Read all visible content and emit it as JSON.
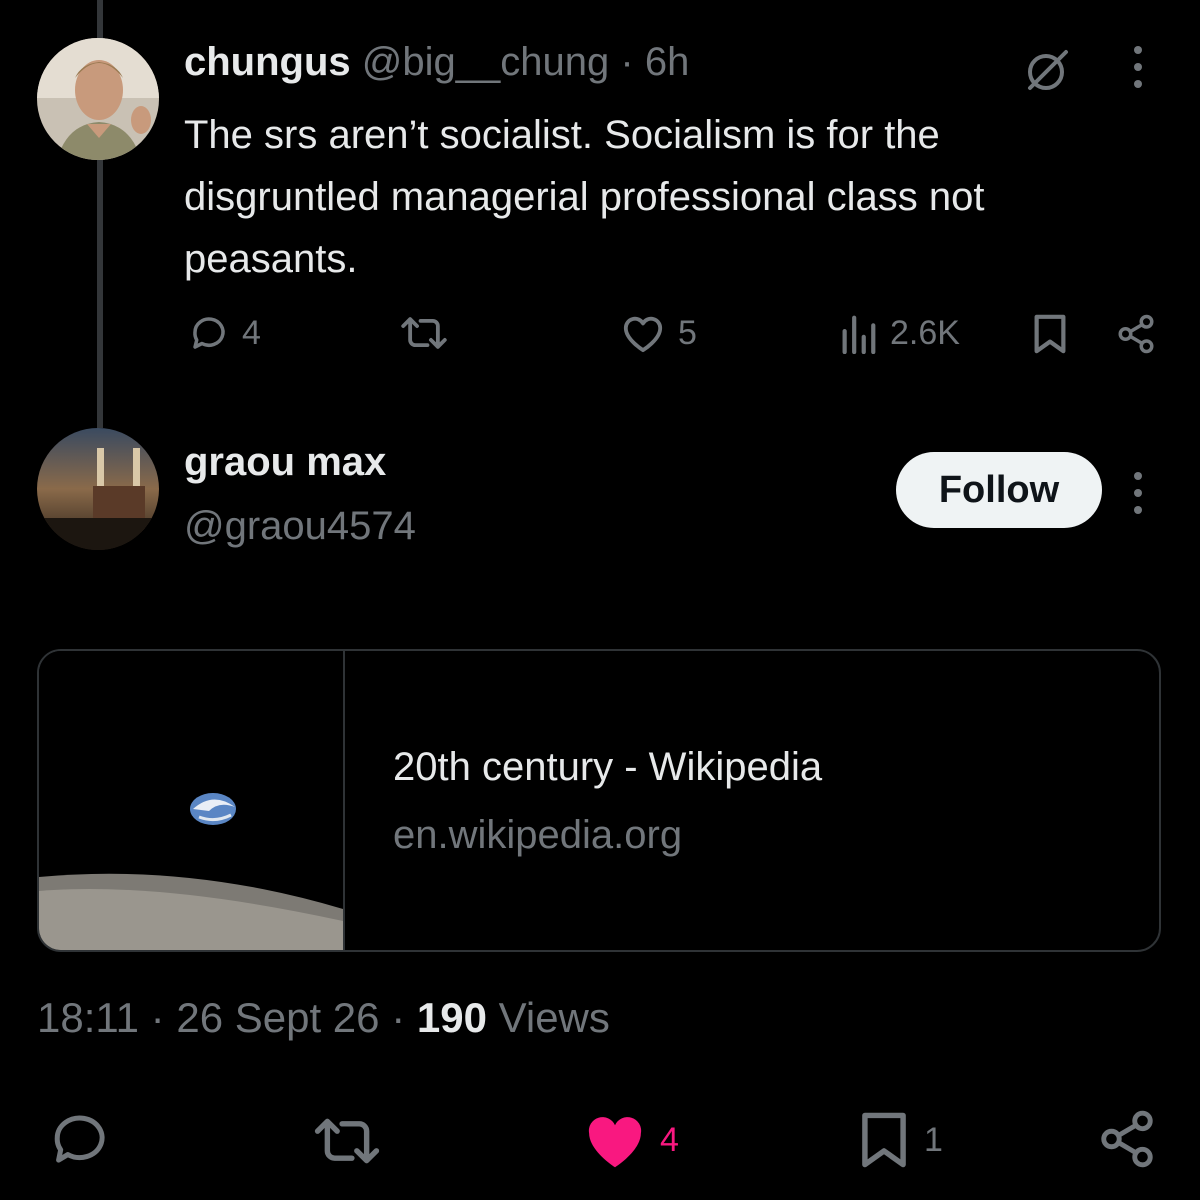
{
  "parent_tweet": {
    "display_name": "chungus",
    "handle": "@big__chung",
    "separator": "·",
    "time": "6h",
    "text": "The srs aren’t socialist. Socialism is for the disgruntled managerial professional class not peasants.",
    "actions": {
      "replies": "4",
      "likes": "5",
      "views": "2.6K"
    }
  },
  "reply_tweet": {
    "display_name": "graou max",
    "handle": "@graou4574",
    "follow_label": "Follow",
    "link_card": {
      "title": "20th century - Wikipedia",
      "domain": "en.wikipedia.org"
    },
    "meta": {
      "time": "18:11",
      "dot1": "·",
      "date": "26 Sept 26",
      "dot2": "·",
      "views_count": "190",
      "views_label": "Views"
    },
    "actions": {
      "likes": "4",
      "bookmarks": "1"
    }
  },
  "colors": {
    "background": "#000000",
    "text": "#e7e9ea",
    "muted": "#71767b",
    "like_active": "#f91880",
    "follow_bg": "#eff3f4"
  },
  "icons": [
    "grok-icon",
    "more-icon",
    "reply-icon",
    "repost-icon",
    "like-icon",
    "views-icon",
    "bookmark-icon",
    "share-icon"
  ]
}
